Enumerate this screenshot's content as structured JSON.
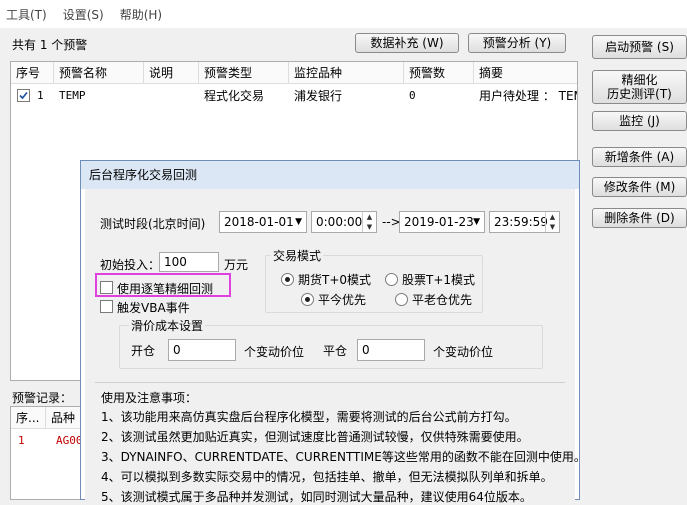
{
  "menu": [
    "工具(T)",
    "设置(S)",
    "帮助(H)"
  ],
  "summary": "共有 1 个预警",
  "top_buttons": {
    "data_fill": "数据补充 (W)",
    "alert_analysis": "预警分析 (Y)"
  },
  "right_buttons": [
    "启动预警 (S)",
    "精细化\n历史测评(T)",
    "监控 (J)",
    "新增条件 (A)",
    "修改条件 (M)",
    "删除条件 (D)"
  ],
  "table": {
    "headers": [
      "序号",
      "预警名称",
      "说明",
      "预警类型",
      "监控品种",
      "预警数",
      "摘要"
    ],
    "row": {
      "checked": true,
      "index": "1",
      "name": "TEMP",
      "desc": "",
      "type": "程式化交易",
      "symbol": "浦发银行",
      "count": "0",
      "summary": "用户待处理 ： TEMP"
    }
  },
  "records": {
    "label": "预警记录：",
    "headers": [
      "序...",
      "品种"
    ],
    "row": {
      "index": "1",
      "symbol": "AG00"
    }
  },
  "dialog": {
    "title": "后台程序化交易回测",
    "period_label": "测试时段(北京时间)",
    "start_date": "2018-01-01",
    "start_time": "0:00:00",
    "arrow": "-->",
    "end_date": "2019-01-23",
    "end_time": "23:59:59",
    "capital_label": "初始投入：",
    "capital_value": "100",
    "capital_unit": "万元",
    "opt_tick": "使用逐笔精细回测",
    "opt_vba": "触发VBA事件",
    "mode_title": "交易模式",
    "mode_futures": "期货T+0模式",
    "mode_stock": "股票T+1模式",
    "mode_close_today": "平今优先",
    "mode_close_old": "平老仓优先",
    "slip_title": "滑价成本设置",
    "open_label": "开仓",
    "open_value": "0",
    "open_unit": "个变动价位",
    "close_label": "平仓",
    "close_value": "0",
    "close_unit": "个变动价位",
    "notes_title": "使用及注意事项：",
    "notes": [
      "1、该功能用来高仿真实盘后台程序化模型，需要将测试的后台公式前方打勾。",
      "2、该测试虽然更加贴近真实，但测试速度比普通测试较慢，仅供特殊需要使用。",
      "3、DYNAINFO、CURRENTDATE、CURRENTTIME等这些常用的函数不能在回测中使用。",
      "4、可以模拟到多数实际交易中的情况，包括挂单、撤单，但无法模拟队列单和拆单。",
      "5、该测试模式属于多品种并发测试，如同时测试大量品种，建议使用64位版本。"
    ]
  }
}
